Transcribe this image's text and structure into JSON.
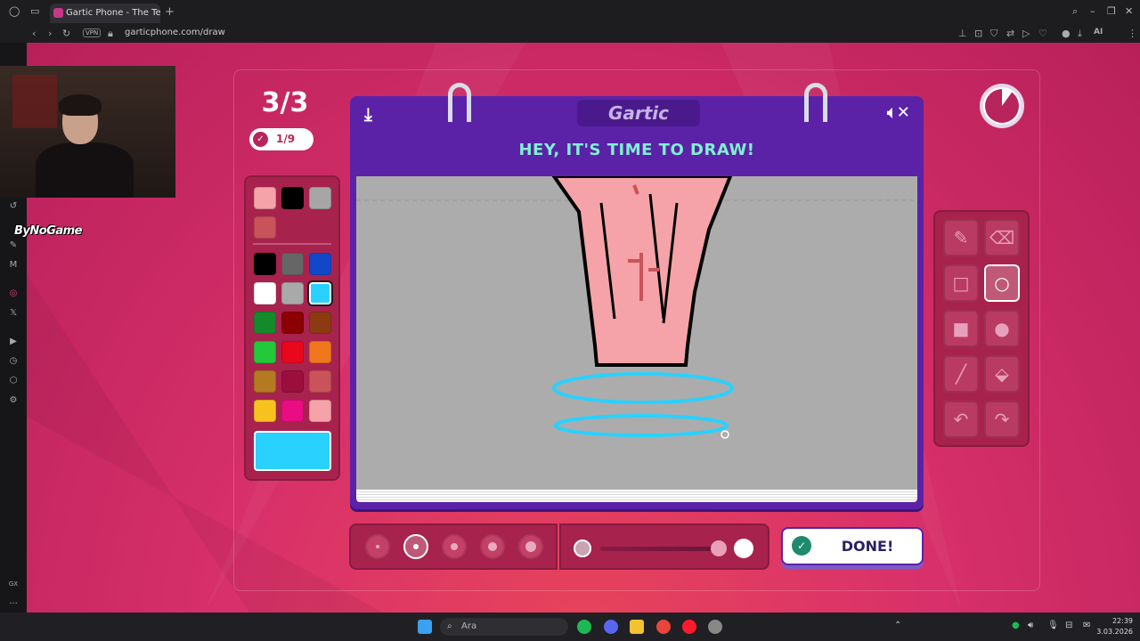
{
  "browser": {
    "tab_title": "Gartic Phone - The Teleph",
    "url": "garticphone.com/draw",
    "vpn_label": "VPN",
    "ai_label": "AI"
  },
  "stream": {
    "overlay_name": "ByNoGame"
  },
  "game": {
    "round": "3/3",
    "progress": "1/9",
    "logo": "Gartic",
    "title": "HEY, IT'S TIME TO DRAW!",
    "done_label": "DONE!",
    "timer_elapsed_fraction": 0.9
  },
  "palette": {
    "recent": [
      "#f5a3a8",
      "#000000",
      "#a6a6a6",
      "#c8545a"
    ],
    "colors": [
      "#000000",
      "#666666",
      "#1247c8",
      "#ffffff",
      "#a9a9a9",
      "#29d1ff",
      "#148a2c",
      "#8b0000",
      "#8b3a12",
      "#22c93a",
      "#e8071c",
      "#f0771e",
      "#b37a22",
      "#9b0f3d",
      "#c8545a",
      "#f8c21e",
      "#ea0c82",
      "#f5a3a8"
    ],
    "selected": "#29d1ff",
    "current": "#29d1ff"
  },
  "tools": {
    "items": [
      "pencil",
      "eraser",
      "rectangle-outline",
      "ellipse-outline",
      "rectangle-filled",
      "ellipse-filled",
      "line",
      "fill-bucket",
      "undo",
      "redo"
    ],
    "selected": "ellipse-outline"
  },
  "brush": {
    "sizes": [
      1,
      2,
      3,
      4,
      5
    ],
    "selected_size": 2,
    "opacity": 1.0
  },
  "taskbar": {
    "search_placeholder": "Ara",
    "time": "22:39",
    "date": "3.03.2026"
  },
  "sidebar": {
    "gx_label": "GX",
    "more_label": "..."
  }
}
